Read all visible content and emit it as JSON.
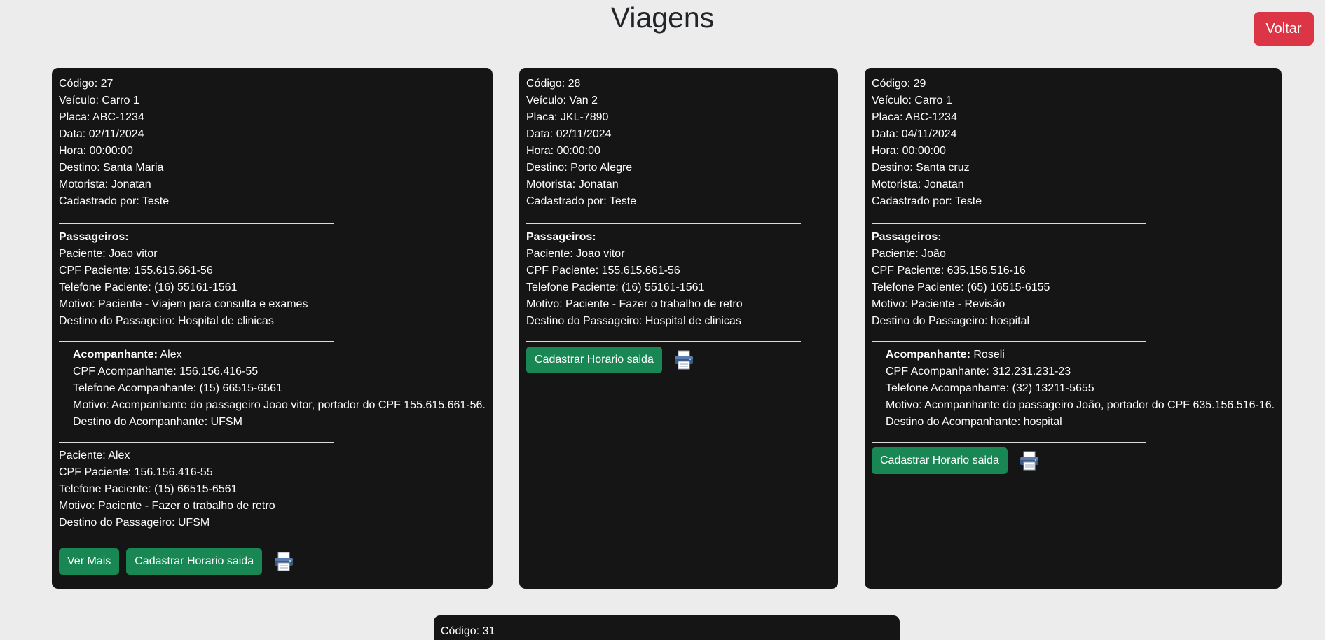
{
  "header": {
    "title": "Viagens",
    "back_label": "Voltar"
  },
  "labels": {
    "codigo": "Código: ",
    "veiculo": "Veículo: ",
    "placa": "Placa: ",
    "data": "Data: ",
    "hora": "Hora: ",
    "destino": "Destino: ",
    "motorista": "Motorista: ",
    "cadastrado_por": "Cadastrado por: ",
    "passageiros": "Passageiros:",
    "paciente": "Paciente: ",
    "cpf_paciente": "CPF Paciente: ",
    "telefone_paciente": "Telefone Paciente: ",
    "motivo": "Motivo: ",
    "destino_passageiro": "Destino do Passageiro: ",
    "acompanhante": "Acompanhante:",
    "cpf_acompanhante": "CPF Acompanhante: ",
    "telefone_acompanhante": "Telefone Acompanhante: ",
    "destino_acompanhante": "Destino do Acompanhante: "
  },
  "buttons": {
    "ver_mais": "Ver Mais",
    "cadastrar_horario": "Cadastrar Horario saida",
    "print_icon": "printer-icon"
  },
  "colors": {
    "accent_green": "#198754",
    "danger_red": "#dc3545",
    "card_bg": "#151515",
    "page_bg": "#ececec"
  },
  "trips": [
    {
      "codigo": "27",
      "veiculo": "Carro 1",
      "placa": "ABC-1234",
      "data": "02/11/2024",
      "hora": "00:00:00",
      "destino": "Santa Maria",
      "motorista": "Jonatan",
      "cadastrado_por": "Teste",
      "passengers": [
        {
          "paciente": "Joao vitor",
          "cpf": "155.615.661-56",
          "telefone": "(16) 55161-1561",
          "motivo": "Paciente - Viajem para consulta e exames",
          "destino": "Hospital de clinicas",
          "acompanhante": {
            "nome": "Alex",
            "cpf": "156.156.416-55",
            "telefone": "(15) 66515-6561",
            "motivo": "Acompanhante do passageiro Joao vitor, portador do CPF 155.615.661-56.",
            "destino": "UFSM"
          }
        },
        {
          "paciente": "Alex",
          "cpf": "156.156.416-55",
          "telefone": "(15) 66515-6561",
          "motivo": "Paciente - Fazer o trabalho de retro",
          "destino": "UFSM"
        }
      ]
    },
    {
      "codigo": "28",
      "veiculo": "Van 2",
      "placa": "JKL-7890",
      "data": "02/11/2024",
      "hora": "00:00:00",
      "destino": "Porto Alegre",
      "motorista": "Jonatan",
      "cadastrado_por": "Teste",
      "passengers": [
        {
          "paciente": "Joao vitor",
          "cpf": "155.615.661-56",
          "telefone": "(16) 55161-1561",
          "motivo": "Paciente - Fazer o trabalho de retro",
          "destino": "Hospital de clinicas"
        }
      ]
    },
    {
      "codigo": "29",
      "veiculo": "Carro 1",
      "placa": "ABC-1234",
      "data": "04/11/2024",
      "hora": "00:00:00",
      "destino": "Santa cruz",
      "motorista": "Jonatan",
      "cadastrado_por": "Teste",
      "passengers": [
        {
          "paciente": "João",
          "cpf": "635.156.516-16",
          "telefone": "(65) 16515-6155",
          "motivo": "Paciente - Revisão",
          "destino": "hospital",
          "acompanhante": {
            "nome": "Roseli",
            "cpf": "312.231.231-23",
            "telefone": "(32) 13211-5655",
            "motivo": "Acompanhante do passageiro João, portador do CPF 635.156.516-16.",
            "destino": "hospital"
          }
        }
      ]
    },
    {
      "codigo": "31"
    }
  ]
}
